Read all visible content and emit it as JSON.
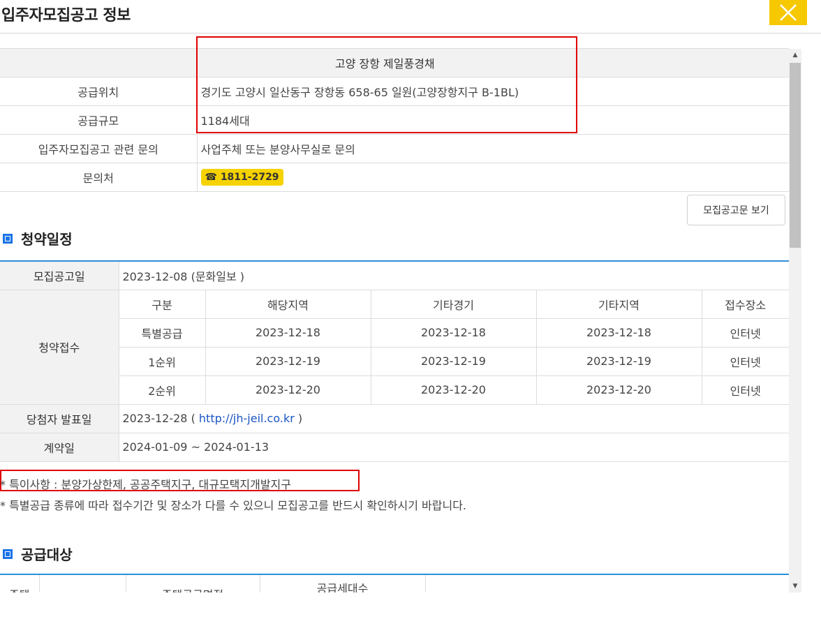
{
  "window": {
    "title": "입주자모집공고 정보",
    "close_icon": "close-icon"
  },
  "info": {
    "complex_name": "고양 장항 제일풍경채",
    "rows": [
      {
        "label": "공급위치",
        "value": "경기도 고양시 일산동구 장항동 658-65 일원(고양장항지구 B-1BL)"
      },
      {
        "label": "공급규모",
        "value": "1184세대"
      },
      {
        "label": "입주자모집공고 관련 문의",
        "value": "사업주체 또는 분양사무실로 문의"
      }
    ],
    "contact_label": "문의처",
    "contact_phone": "☎ 1811-2729"
  },
  "notice_button": "모집공고문 보기",
  "schedule": {
    "heading": "청약일정",
    "announcement_label": "모집공고일",
    "announcement_value": "2023-12-08 (문화일보 )",
    "reception_label": "청약접수",
    "columns": [
      "구분",
      "해당지역",
      "기타경기",
      "기타지역",
      "접수장소"
    ],
    "rows": [
      [
        "특별공급",
        "2023-12-18",
        "2023-12-18",
        "2023-12-18",
        "인터넷"
      ],
      [
        "1순위",
        "2023-12-19",
        "2023-12-19",
        "2023-12-19",
        "인터넷"
      ],
      [
        "2순위",
        "2023-12-20",
        "2023-12-20",
        "2023-12-20",
        "인터넷"
      ]
    ],
    "winner_label": "당첨자 발표일",
    "winner_date": "2023-12-28 (",
    "winner_link": "http://jh-jeil.co.kr",
    "winner_close": ")",
    "contract_label": "계약일",
    "contract_value": "2024-01-09 ~ 2024-01-13"
  },
  "notes": [
    "* 특이사항 : 분양가상한제, 공공주택지구, 대규모택지개발지구",
    "* 특별공급 종류에 따라 접수기간 및 장소가 다를 수 있으니 모집공고를 반드시 확인하시기 바랍니다."
  ],
  "supply": {
    "heading": "공급대상",
    "columns": [
      "주택",
      "",
      "주택공급면적",
      "공급세대수",
      ""
    ]
  },
  "colors": {
    "accent": "#1a73e8",
    "close_bg": "#f6c800",
    "highlight": "#e00000",
    "phone_badge": "#f6d200"
  }
}
